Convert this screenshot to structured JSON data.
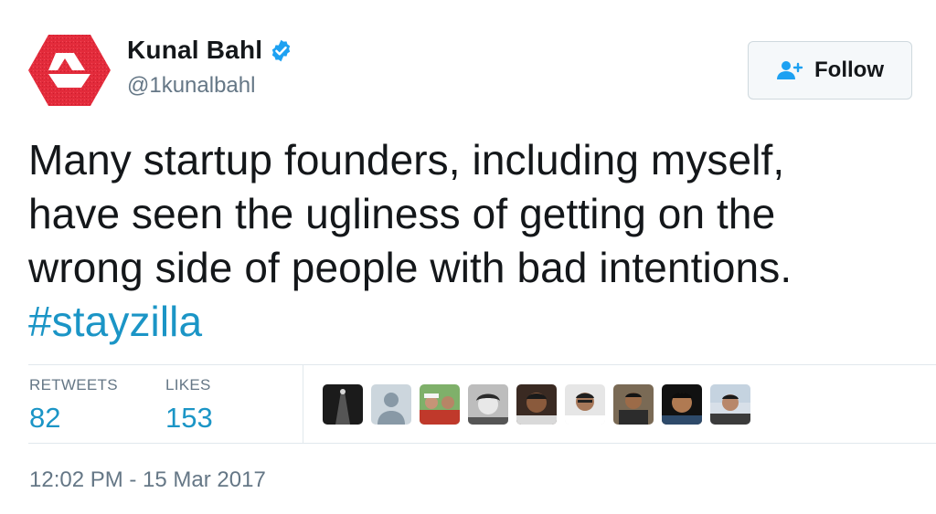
{
  "user": {
    "name": "Kunal Bahl",
    "handle": "@1kunalbahl",
    "verified": true,
    "avatar_color": "#e8303f"
  },
  "follow_button": {
    "label": "Follow"
  },
  "tweet": {
    "lines": [
      "Many startup founders, including myself,",
      "have seen the ugliness of getting on the",
      "wrong side of people with bad intentions."
    ],
    "hashtag": "#stayzilla"
  },
  "stats": {
    "retweets_label": "RETWEETS",
    "retweets_value": "82",
    "likes_label": "LIKES",
    "likes_value": "153"
  },
  "likers": [
    {
      "icon": "liker-avatar-1"
    },
    {
      "icon": "liker-avatar-2-default"
    },
    {
      "icon": "liker-avatar-3"
    },
    {
      "icon": "liker-avatar-4"
    },
    {
      "icon": "liker-avatar-5"
    },
    {
      "icon": "liker-avatar-6"
    },
    {
      "icon": "liker-avatar-7"
    },
    {
      "icon": "liker-avatar-8"
    },
    {
      "icon": "liker-avatar-9"
    }
  ],
  "timestamp": "12:02 PM - 15 Mar 2017",
  "colors": {
    "link": "#1b95c6",
    "muted": "#657786",
    "verified": "#1da1f2"
  }
}
